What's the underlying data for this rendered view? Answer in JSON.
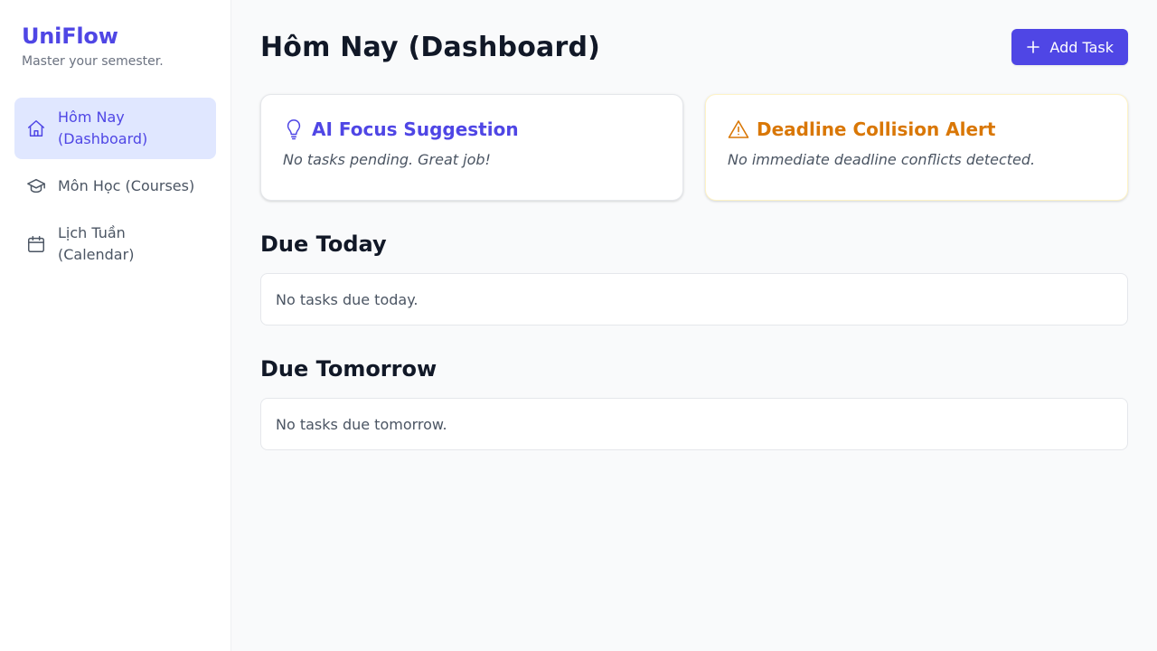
{
  "sidebar": {
    "brand": "UniFlow",
    "tagline": "Master your semester.",
    "items": [
      {
        "label": "Hôm Nay\n(Dashboard)",
        "icon": "home-icon",
        "active": true
      },
      {
        "label": "Môn Học (Courses)",
        "icon": "graduation-cap-icon",
        "active": false
      },
      {
        "label": "Lịch Tuần\n(Calendar)",
        "icon": "calendar-icon",
        "active": false
      }
    ]
  },
  "header": {
    "title": "Hôm Nay (Dashboard)",
    "add_button_label": "Add Task",
    "add_button_icon": "plus-icon"
  },
  "cards": {
    "focus": {
      "title": "AI Focus Suggestion",
      "text": "No tasks pending. Great job!",
      "icon": "lightbulb-icon",
      "color": "#4f46e5"
    },
    "alert": {
      "title": "Deadline Collision Alert",
      "text": "No immediate deadline conflicts detected.",
      "icon": "warning-icon",
      "color": "#d97706"
    }
  },
  "sections": {
    "today": {
      "title": "Due Today",
      "empty_text": "No tasks due today."
    },
    "tomorrow": {
      "title": "Due Tomorrow",
      "empty_text": "No tasks due tomorrow."
    }
  },
  "colors": {
    "accent": "#4f46e5",
    "active_bg": "#e0e7ff",
    "warning": "#d97706"
  }
}
